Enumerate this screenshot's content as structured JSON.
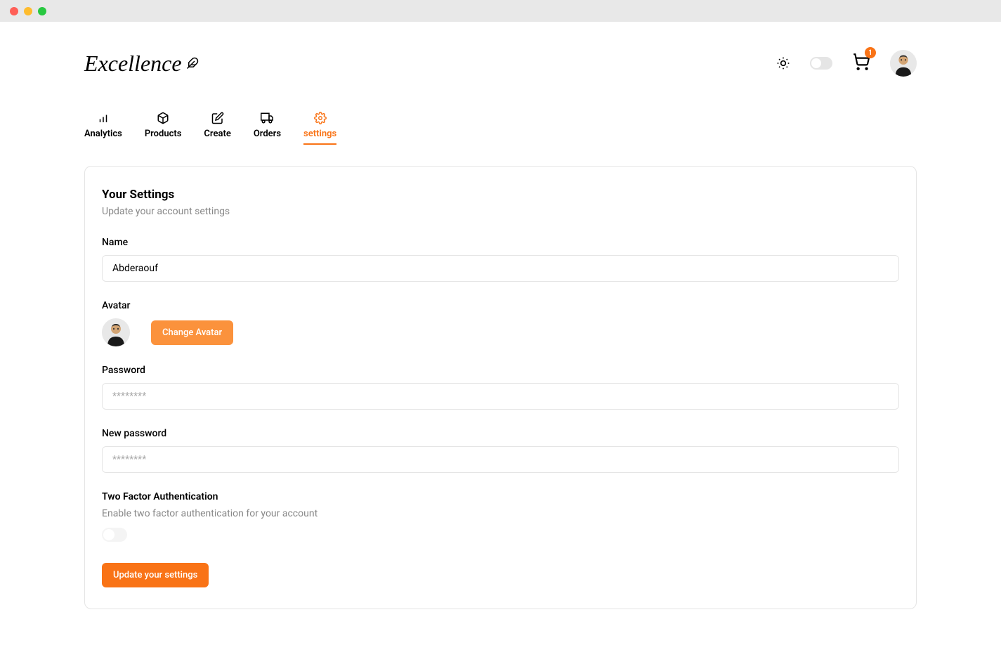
{
  "brand": "Excellence",
  "header": {
    "cart_count": "1"
  },
  "tabs": [
    {
      "label": "Analytics",
      "icon": "bar-chart-icon"
    },
    {
      "label": "Products",
      "icon": "package-icon"
    },
    {
      "label": "Create",
      "icon": "edit-icon"
    },
    {
      "label": "Orders",
      "icon": "truck-icon"
    },
    {
      "label": "settings",
      "icon": "settings-icon",
      "active": true
    }
  ],
  "settings": {
    "title": "Your Settings",
    "subtitle": "Update your account settings",
    "name_label": "Name",
    "name_value": "Abderaouf",
    "avatar_label": "Avatar",
    "change_avatar_label": "Change Avatar",
    "password_label": "Password",
    "password_placeholder": "********",
    "new_password_label": "New password",
    "new_password_placeholder": "********",
    "twofa_title": "Two Factor Authentication",
    "twofa_desc": "Enable two factor authentication for your account",
    "submit_label": "Update your settings"
  }
}
